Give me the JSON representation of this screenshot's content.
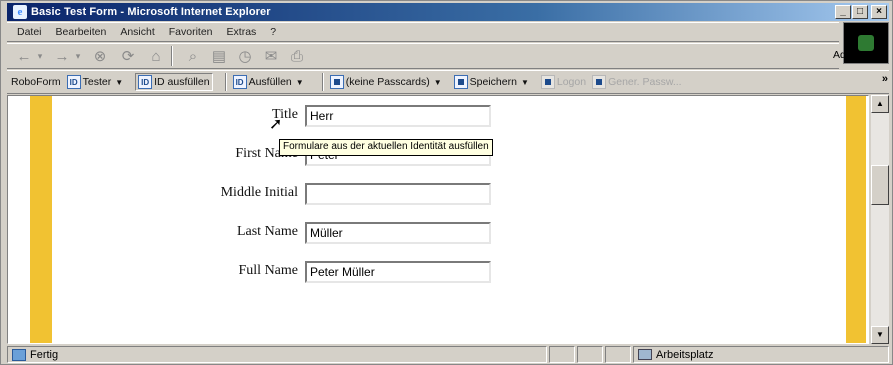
{
  "window": {
    "title": "Basic Test Form - Microsoft Internet Explorer",
    "app_icon": "ie-logo-icon"
  },
  "title_buttons": [
    "_",
    "□",
    "×"
  ],
  "menu": [
    {
      "label": "Datei"
    },
    {
      "label": "Bearbeiten"
    },
    {
      "label": "Ansicht"
    },
    {
      "label": "Favoriten"
    },
    {
      "label": "Extras"
    },
    {
      "label": "?"
    }
  ],
  "nav": {
    "buttons": [
      "back-icon",
      "forward-icon",
      "stop-icon",
      "refresh-icon",
      "home-icon",
      "search-icon",
      "favorites-icon",
      "history-icon",
      "mail-icon",
      "print-icon"
    ],
    "address_label": "Adresse"
  },
  "roboform": {
    "brand": "RoboForm",
    "tester": "Tester",
    "id_fill": "ID ausfüllen",
    "fill": "Ausfüllen",
    "passcards": "(keine Passcards)",
    "save": "Speichern",
    "login": "Logon",
    "generate": "Gener. Passw...",
    "more": "»"
  },
  "tooltip": "Formulare aus der aktuellen Identität ausfüllen",
  "form": {
    "fields": [
      {
        "label": "Title",
        "value": "Herr"
      },
      {
        "label": "First Name",
        "value": "Peter"
      },
      {
        "label": "Middle Initial",
        "value": ""
      },
      {
        "label": "Last Name",
        "value": "Müller"
      },
      {
        "label": "Full Name",
        "value": "Peter Müller"
      }
    ]
  },
  "status": {
    "text": "Fertig",
    "zone": "Arbeitsplatz"
  },
  "colors": {
    "title_bar": "#0a246a",
    "stripe": "#f1c232",
    "chrome": "#d4d0c8",
    "tooltip_bg": "#ffffe1"
  }
}
